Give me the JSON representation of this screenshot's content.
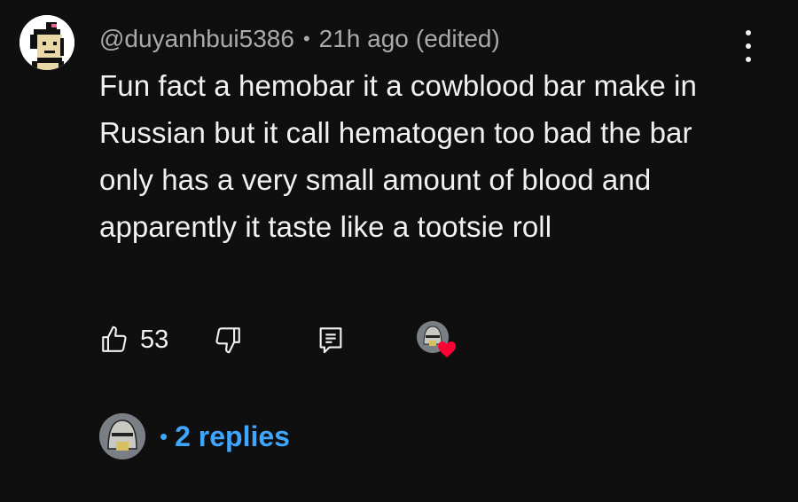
{
  "comment": {
    "author_handle": "@duyanhbui5386",
    "separator": "•",
    "time_ago": "21h ago",
    "edited_label": "(edited)",
    "text": "Fun fact a hemobar it a cowblood bar make in Russian but it call hematogen too bad the bar only has a very small amount of blood and apparently it taste like a tootsie roll",
    "like_count": "53",
    "icons": {
      "avatar": "pixel-art-avatar",
      "more": "more-vertical-icon",
      "like": "thumbs-up-icon",
      "dislike": "thumbs-down-icon",
      "reply": "reply-icon",
      "creator_heart": "creator-heart-icon"
    },
    "colors": {
      "background": "#0f0f0f",
      "text": "#f1f1f1",
      "meta": "#aaaaaa",
      "link": "#3ea6ff",
      "heart": "#ff0033"
    }
  },
  "replies": {
    "separator": "•",
    "label": "2 replies"
  }
}
